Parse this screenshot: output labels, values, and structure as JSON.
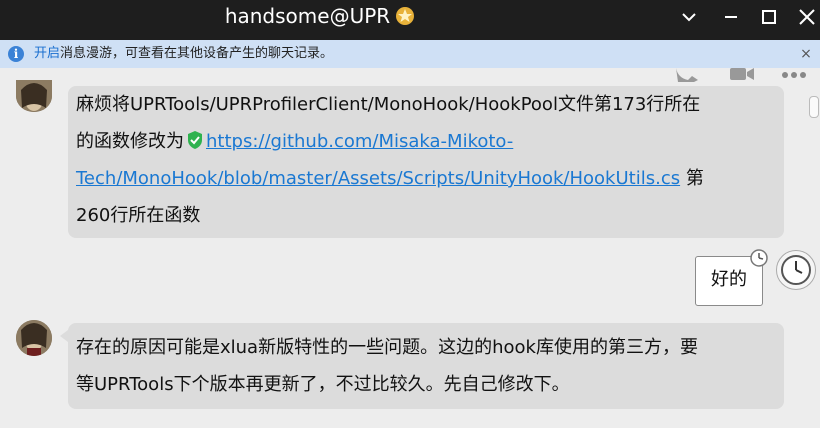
{
  "window": {
    "title": "handsome@UPR",
    "controls": [
      "chevron-down-icon",
      "minimize-icon",
      "maximize-icon",
      "close-icon"
    ]
  },
  "notice": {
    "link_text": "开启",
    "text": "消息漫游，可查看在其他设备产生的聊天记录。",
    "close": "×"
  },
  "messages": [
    {
      "side": "left",
      "line1": "麻烦将UPRTools/UPRProfilerClient/MonoHook/HookPool文件第173行所在",
      "line2_prefix": "的函数修改为",
      "link_part1": "https://github.com/Misaka-Mikoto-",
      "link_part2": "Tech/MonoHook/blob/master/Assets/Scripts/UnityHook/HookUtils.cs",
      "line3_suffix": " 第",
      "line4": "260行所在函数"
    },
    {
      "side": "right",
      "text": "好的"
    },
    {
      "side": "left",
      "line1": "存在的原因可能是xlua新版特性的一些问题。这边的hook库使用的第三方，要",
      "line2": "等UPRTools下个版本再更新了，不过比较久。先自己修改下。"
    }
  ],
  "colors": {
    "titlebar": "#1e1e1e",
    "notice_bg": "#cfe0f5",
    "link": "#1a78d2",
    "bubble_left": "#dcdcdc",
    "chat_bg": "#ededed"
  }
}
